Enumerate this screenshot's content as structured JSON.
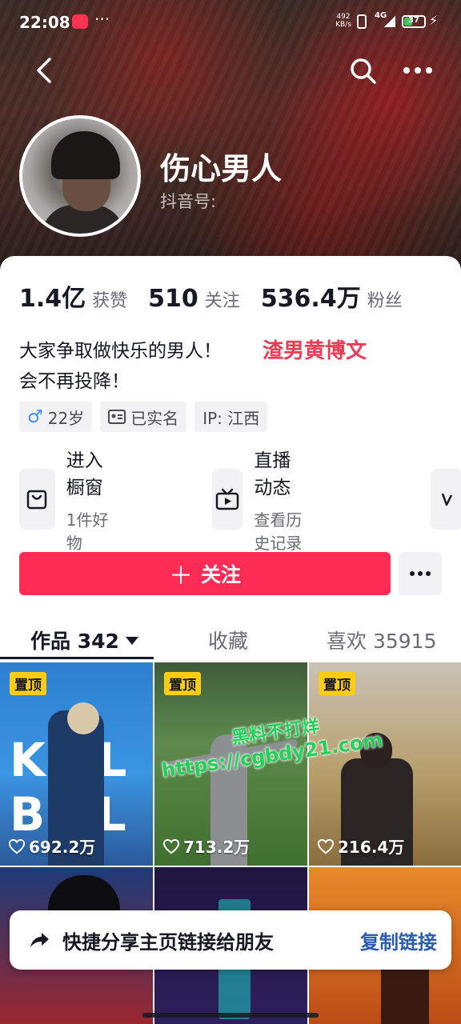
{
  "status_bar": {
    "time": "22:08",
    "network_speed_value": "492",
    "network_speed_unit": "KB/s",
    "signal": "4G",
    "battery": "37"
  },
  "profile": {
    "nickname": "伤心男人",
    "douyin_id_label": "抖音号:"
  },
  "stats": [
    {
      "value": "1.4亿",
      "label": "获赞"
    },
    {
      "value": "510",
      "label": "关注"
    },
    {
      "value": "536.4万",
      "label": "粉丝"
    }
  ],
  "bio": {
    "line1": "大家争取做快乐的男人！",
    "line2": "会不再投降！",
    "overlay_text": "渣男黄博文"
  },
  "tags": {
    "age": "22岁",
    "verified": "已实名",
    "ip": "IP: 江西"
  },
  "entries": [
    {
      "title": "进入橱窗",
      "subtitle": "1件好物",
      "icon": "shopping-bag-icon"
    },
    {
      "title": "直播动态",
      "subtitle": "查看历史记录",
      "icon": "tv-icon"
    }
  ],
  "follow_button": "关注",
  "tabs": {
    "works": "作品 342",
    "favorites": "收藏",
    "likes": "喜欢 35915"
  },
  "videos": [
    {
      "pinned": "置顶",
      "likes": "692.2万",
      "poster_text": "KILL BILL"
    },
    {
      "pinned": "置顶",
      "likes": "713.2万"
    },
    {
      "pinned": "置顶",
      "likes": "216.4万"
    },
    {},
    {},
    {}
  ],
  "watermark": {
    "line1": "黑料不打烊",
    "line2": "https://cgbdy21.com"
  },
  "share_bar": {
    "message": "快捷分享主页链接给朋友",
    "action": "复制链接"
  },
  "colors": {
    "primary": "#fe2c55",
    "link": "#2a5db0",
    "pin_badge": "#facc15"
  }
}
